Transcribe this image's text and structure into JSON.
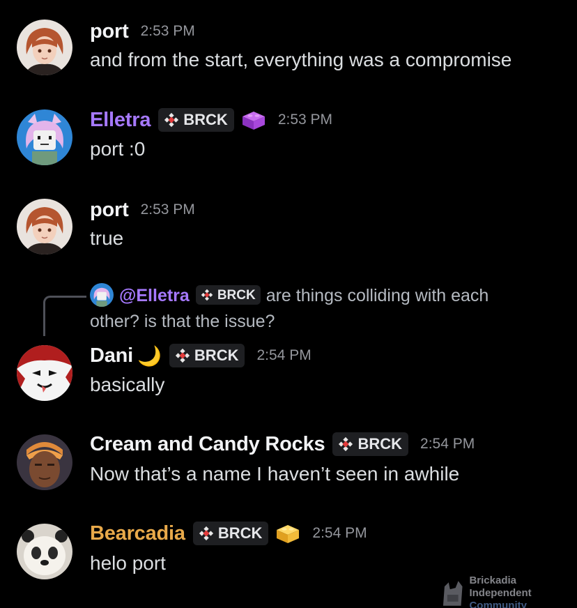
{
  "colors": {
    "background": "#000000",
    "name_default": "#f2f3f5",
    "name_elletra": "#a679ff",
    "name_bearcadia": "#e8a94a",
    "timestamp": "#94969c",
    "tag_bg": "#1e1f22"
  },
  "messages": [
    {
      "author": "port",
      "time": "2:53 PM",
      "text": "and from the start, everything was a compromise"
    },
    {
      "author": "Elletra",
      "tag": "BRCK",
      "badge_icon": "purple-brick-icon",
      "time": "2:53 PM",
      "text": "port :0"
    },
    {
      "author": "port",
      "time": "2:53 PM",
      "text": "true"
    },
    {
      "reply": {
        "mention": "@Elletra",
        "tag": "BRCK",
        "text": "are things colliding with each other? is that the issue?"
      },
      "author": "Dani",
      "author_emoji": "🌙",
      "tag": "BRCK",
      "time": "2:54 PM",
      "text": "basically"
    },
    {
      "author": "Cream and Candy Rocks",
      "tag": "BRCK",
      "time": "2:54 PM",
      "text": "Now that’s a name I haven’t seen in awhile"
    },
    {
      "author": "Bearcadia",
      "tag": "BRCK",
      "badge_icon": "yellow-brick-icon",
      "time": "2:54 PM",
      "text": "helo port"
    }
  ],
  "watermark": {
    "line1": "Brickadia Independent",
    "line2": "Community"
  }
}
